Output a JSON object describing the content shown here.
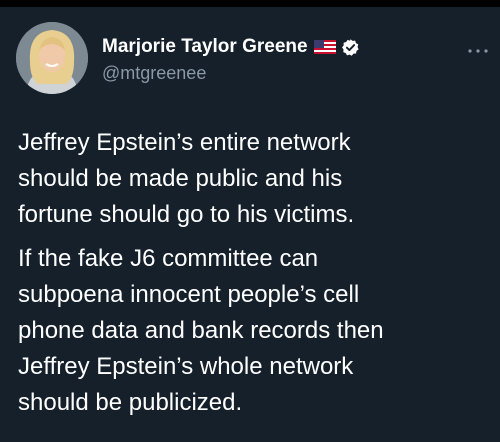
{
  "author": {
    "display_name": "Marjorie Taylor Greene",
    "handle": "@mtgreenee",
    "flag_icon": "us-flag-icon",
    "verified_icon": "verified-badge-icon"
  },
  "more_icon": "more-options-icon",
  "tweet": {
    "paragraphs": [
      {
        "lines": [
          "Jeffrey Epstein’s entire network",
          "should be made public and his",
          "fortune should go to his victims."
        ]
      },
      {
        "lines": [
          "If the fake J6 committee can",
          "subpoena innocent people’s cell",
          "phone data and bank records then",
          "Jeffrey Epstein’s whole network",
          "should be publicized."
        ]
      }
    ]
  },
  "colors": {
    "background": "#15202b",
    "text_primary": "#ffffff",
    "text_secondary": "#8b98a5",
    "verified_badge": "#ffffff"
  }
}
